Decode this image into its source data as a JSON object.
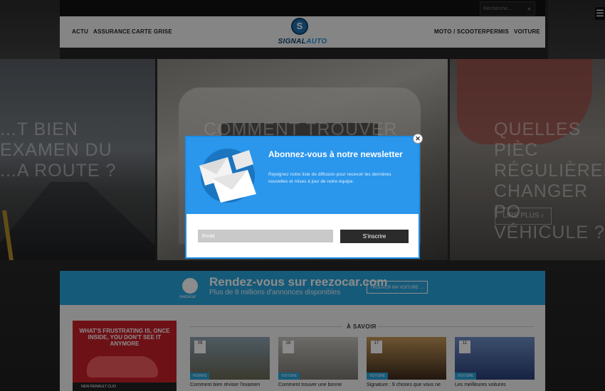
{
  "topbar": {
    "search_placeholder": "Recherche..."
  },
  "nav": {
    "left": [
      "ACTU",
      "ASSURANCE",
      "CARTE GRISE"
    ],
    "right": [
      "MOTO / SCOOTER",
      "PERMIS",
      "VOITURE"
    ],
    "logo_signal": "SIGNAL",
    "logo_auto": "AUTO"
  },
  "hero": {
    "card1": "...T BIEN\nEXAMEN DU\n...A ROUTE ?",
    "card2": "COMMENT TROUVER",
    "card3": "QUELLES PIÈC\nRÉGULIÈREM\nCHANGER PO\nVÉHICULE ?",
    "read_more": "LIRE PLUS"
  },
  "banner": {
    "brand": "reezocar",
    "title": "Rendez-vous sur reezocar.com",
    "subtitle": "Plus de 8 millions d'annonces disponibles",
    "button": "TROUVER MA VOITURE"
  },
  "section": {
    "title": "À SAVOIR"
  },
  "ad": {
    "text": "WHAT'S FRUSTRATING IS, ONCE INSIDE, YOU DON'T SEE IT ANYMORE",
    "footer": "NEW RENAULT CLIO"
  },
  "cards": [
    {
      "date": "09",
      "tag": "PERMIS",
      "title": "Comment bien réviser l'examen"
    },
    {
      "date": "28",
      "tag": "VOITURE",
      "title": "Comment trouver une bonne"
    },
    {
      "date": "17",
      "tag": "VOITURE",
      "title": "Signature : 9 choses que vous ne"
    },
    {
      "date": "11",
      "tag": "VOITURE",
      "title": "Les meilleures voitures"
    }
  ],
  "popup": {
    "title": "Abonnez-vous à notre newsletter",
    "description": "Rejoignez notre liste de diffusion pour recevoir les dernières nouvelles et mises à jour de notre équipe.",
    "email_placeholder": "Email",
    "button": "S'inscrire"
  },
  "colors": {
    "accent": "#2a96ec",
    "banner": "#29a4dc",
    "logo_dark": "#0d3c66"
  }
}
